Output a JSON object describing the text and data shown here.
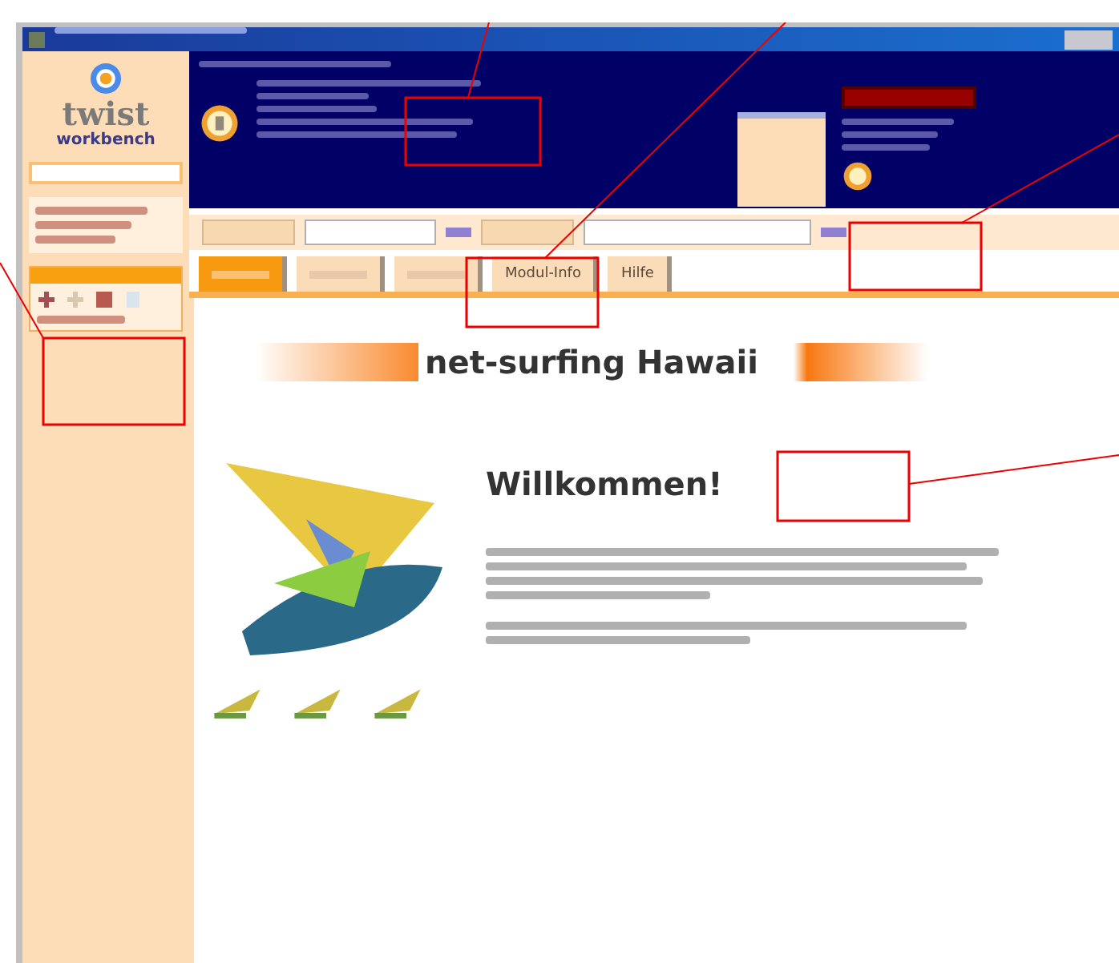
{
  "logo": {
    "name": "twist",
    "subtitle": "workbench"
  },
  "tabs": [
    {
      "selected": true
    },
    {
      "selected": false
    },
    {
      "selected": false
    },
    {
      "label": "Modul-Info",
      "selected": false
    },
    {
      "label": "Hilfe",
      "selected": false
    }
  ],
  "content": {
    "banner": "net-surfing Hawaii",
    "heading": "Willkommen!"
  }
}
